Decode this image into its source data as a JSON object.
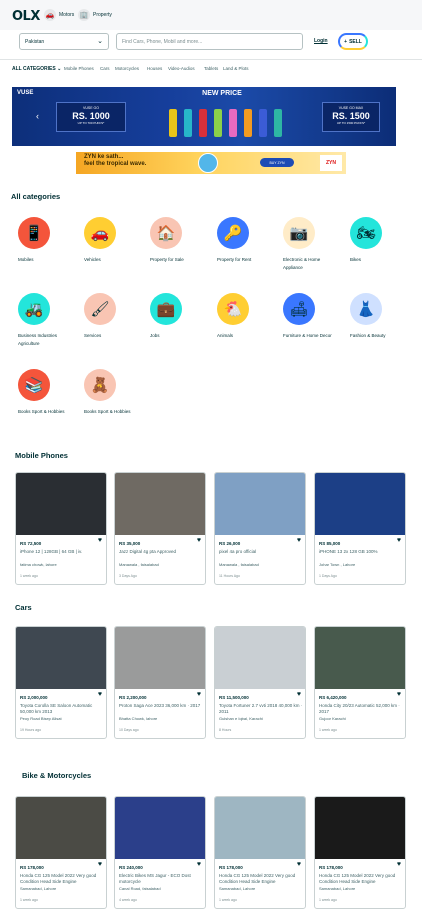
{
  "header": {
    "logo": "OLX",
    "verticals": [
      {
        "label": "Motors",
        "icon": "car-icon"
      },
      {
        "label": "Property",
        "icon": "building-icon"
      }
    ],
    "location_value": "Pakistan",
    "search_placeholder": "Find Cars, Phone, Mobil and more...",
    "login_label": "Login",
    "sell_label": "SELL",
    "sell_icon": "+"
  },
  "category_bar": {
    "all_label": "ALL CATEGORIES",
    "links": [
      "Mobile Phones",
      "Cars",
      "Motorcycles",
      "Houses",
      "Video-Audios",
      "Tablets",
      "Land & Plots"
    ]
  },
  "banner": {
    "brand": "VUSE",
    "left_small": "VUSE GO",
    "left_big": "RS. 1000",
    "left_tiny": "UP TO 700 PUFFS*",
    "center": "NEW PRICE",
    "right_small": "VUSE GO MAX",
    "right_big": "RS. 1500",
    "right_tiny": "UP TO 1500 PUFFS*",
    "pen_colors": [
      "#e8c419",
      "#27b7c9",
      "#d9303a",
      "#8cd14a",
      "#e86ac0",
      "#f39b21",
      "#3b5cd6",
      "#2eb6a4"
    ]
  },
  "banner2": {
    "line1": "ZYN ke sath...",
    "line2": "feel the tropical wave.",
    "button": "BUY ZYN",
    "logo": "ZYN"
  },
  "categories": {
    "title": "All categories",
    "items": [
      {
        "label": "Mobiles",
        "icon": "mobile-icon",
        "glyph": "📱",
        "bg": "#f4553b"
      },
      {
        "label": "Vehicles",
        "icon": "car-icon",
        "glyph": "🚗",
        "bg": "#ffce32"
      },
      {
        "label": "Property for Sale",
        "icon": "house-icon",
        "glyph": "🏠",
        "bg": "#f9c5b3"
      },
      {
        "label": "Property for Rent",
        "icon": "key-icon",
        "glyph": "🔑",
        "bg": "#3a77ff"
      },
      {
        "label": "Electronic & Home Appliance",
        "icon": "camera-icon",
        "glyph": "📷",
        "bg": "#ffecc8"
      },
      {
        "label": "Bikes",
        "icon": "motorbike-icon",
        "glyph": "🏍",
        "bg": "#23e5db"
      },
      {
        "label": "Business Industries Agriculture",
        "icon": "tractor-icon",
        "glyph": "🚜",
        "bg": "#23e5db"
      },
      {
        "label": "Services",
        "icon": "paint-roller-icon",
        "glyph": "🖌",
        "bg": "#f9c5b3"
      },
      {
        "label": "Jobs",
        "icon": "briefcase-icon",
        "glyph": "💼",
        "bg": "#23e5db"
      },
      {
        "label": "Animals",
        "icon": "hen-icon",
        "glyph": "🐔",
        "bg": "#ffce32"
      },
      {
        "label": "Furniture & Home Decor",
        "icon": "sofa-icon",
        "glyph": "🛋",
        "bg": "#3a77ff"
      },
      {
        "label": "Fashion & Beauty",
        "icon": "dress-icon",
        "glyph": "👗",
        "bg": "#cfe0ff"
      },
      {
        "label": "Books Sport & Hobbies",
        "icon": "books-icon",
        "glyph": "📚",
        "bg": "#f4553b"
      },
      {
        "label": "Books Sport & Hobbies",
        "icon": "toys-icon",
        "glyph": "🧸",
        "bg": "#f9c5b3"
      }
    ]
  },
  "sections": [
    {
      "title": "Mobile Phones",
      "cards": [
        {
          "price": "RS 72,500",
          "title": "iPhone 12 | 128GB | 64 GB | iv.",
          "meta": "fatima chowk, lahore",
          "time": "1 week ago",
          "img": "#2a2e33"
        },
        {
          "price": "RS 35,000",
          "title": "Jazz Digital 4g pta Approved",
          "meta": "Manawala , faisalabad",
          "time": "3 Days Ago",
          "img": "#6f6a63"
        },
        {
          "price": "RS 26,000",
          "title": "pixel 4a pro official",
          "meta": "Manawala , faisalabad",
          "time": "11 Hours Ago",
          "img": "#7fa0c4"
        },
        {
          "price": "RS 85,000",
          "title": "iPHONE 13 2x 128 GB 100%",
          "meta": "Johar Town , Lahore",
          "time": "1 Days Ago",
          "img": "#1c3f86"
        }
      ]
    },
    {
      "title": "Cars",
      "cards": [
        {
          "price": "RS 2,000,000",
          "title": "Toyota Corolla SE Saloon Automatic 50,000 km 2013",
          "meta": "Peoy Road Bisep Alisat",
          "time": "19 Hours ago",
          "img": "#3f4851"
        },
        {
          "price": "RS 2,200,000",
          "title": "Proton Saga Ace 2023 36,000 km · 2017",
          "meta": "Bhatta Chowk, lahore",
          "time": "10 Days ago",
          "img": "#9a9b9b"
        },
        {
          "price": "RS 11,500,000",
          "title": "Toyota Fortuner 2.7 vvti 2018 40,000 km · 2011",
          "meta": "Gulshan e Iqbal, Karachi",
          "time": "8 Hours",
          "img": "#c9cfd3"
        },
        {
          "price": "RS 6,420,000",
          "title": "Honda City 20/23 Automatic 52,000 km · 2017",
          "meta": "Gujoor Karachi",
          "time": "1 week ago",
          "img": "#485a4d"
        }
      ]
    },
    {
      "title": "Bike & Motorcycles",
      "cards": [
        {
          "price": "RS 178,000",
          "title": "Honda CG 125 Model 2022 Very good Condition Head Side Engine",
          "meta": "Samanabad, Lahore",
          "time": "1 week ago",
          "img": "#4b4b45"
        },
        {
          "price": "RS 240,000",
          "title": "Electric Bikes MS Jagur - ECO Dost motorcycle",
          "meta": "Canal Road, faisalabad",
          "time": "4 week ago",
          "img": "#2b3f8a"
        },
        {
          "price": "RS 178,000",
          "title": "Honda CG 125 Model 2022 Very good Condition Head Side Engine",
          "meta": "Samanabad, Lahore",
          "time": "1 week ago",
          "img": "#9eb6c2"
        },
        {
          "price": "RS 178,000",
          "title": "Honda CG 125 Model 2022 Very good Condition Head Side Engine",
          "meta": "Samanabad, Lahore",
          "time": "1 week ago",
          "img": "#1a1a1a"
        }
      ]
    }
  ]
}
